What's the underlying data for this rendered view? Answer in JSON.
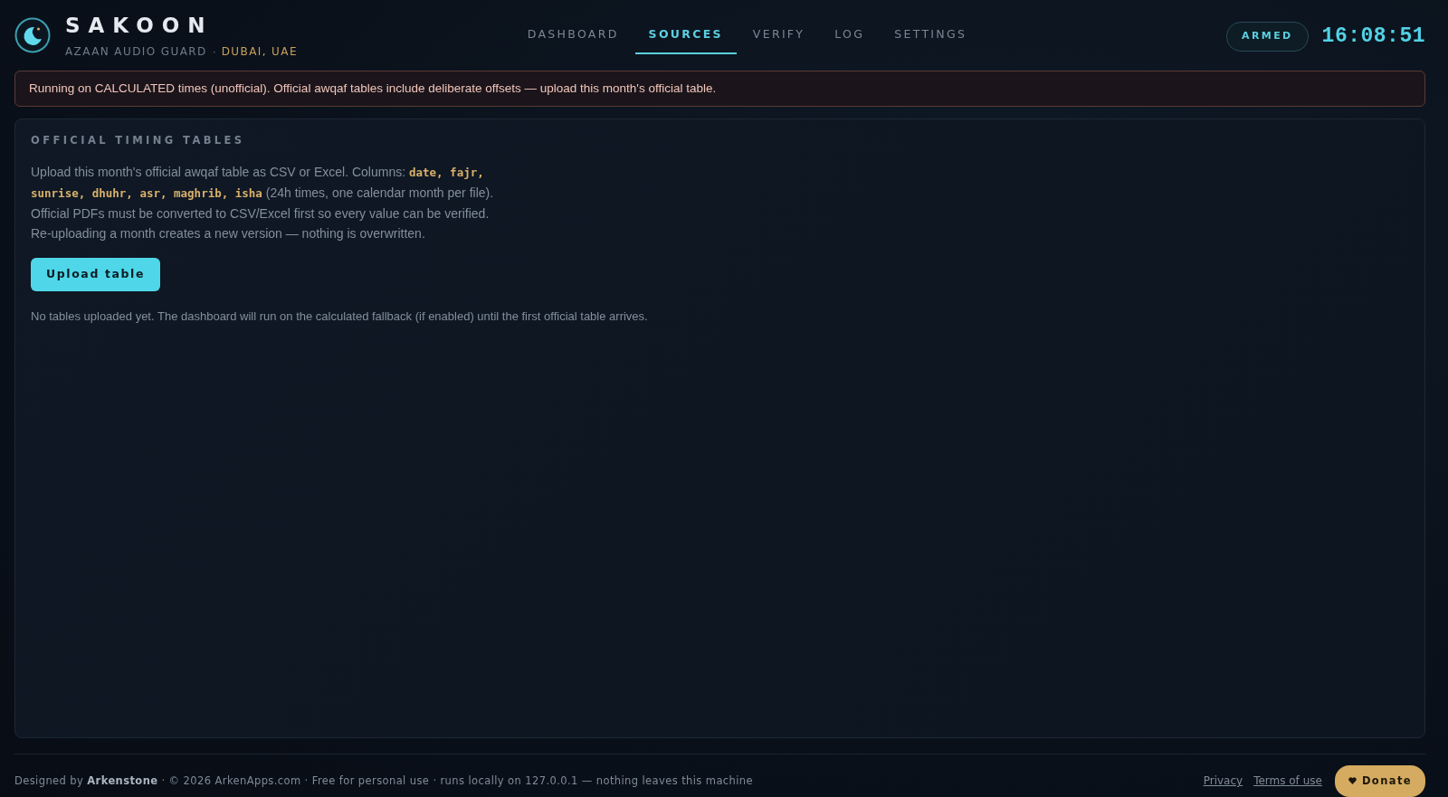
{
  "brand": {
    "title": "SAKOON",
    "subtitle": "AZAAN AUDIO GUARD",
    "separator": "·",
    "location": "DUBAI, UAE"
  },
  "nav": [
    {
      "label": "DASHBOARD",
      "selected": false
    },
    {
      "label": "SOURCES",
      "selected": true
    },
    {
      "label": "VERIFY",
      "selected": false
    },
    {
      "label": "LOG",
      "selected": false
    },
    {
      "label": "SETTINGS",
      "selected": false
    }
  ],
  "status": {
    "badge": "ARMED",
    "clock": "16:08:51"
  },
  "banner": {
    "text": "Running on CALCULATED times (unofficial). Official awqaf tables include deliberate offsets — upload this month's official table."
  },
  "panel": {
    "title": "OFFICIAL TIMING TABLES",
    "description": "Upload this month's official awqaf table as CSV or Excel. Columns: **date, fajr, sunrise, dhuhr, asr, maghrib, isha** (24h times, one calendar month per file). Official PDFs must be converted to CSV/Excel first so every value can be verified. Re-uploading a month creates a new version — nothing is overwritten.",
    "button": "Upload table",
    "note": "No tables uploaded yet. The dashboard will run on the calculated fallback (if enabled) until the first official table arrives."
  },
  "footer": {
    "credits": "Designed by **Arkenstone** · © 2026 ArkenApps.com · Free for personal use · runs locally on 127.0.0.1 — nothing leaves this machine",
    "links": [
      "Privacy",
      "Terms of use"
    ],
    "donate": "Donate"
  }
}
